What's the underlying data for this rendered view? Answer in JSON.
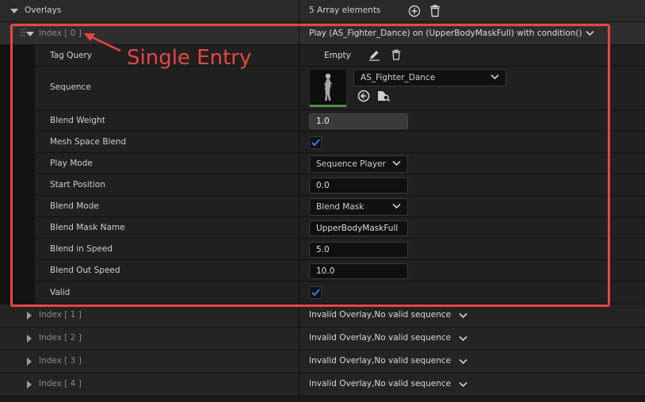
{
  "overlays": {
    "label": "Overlays",
    "summary": "5 Array elements"
  },
  "index0": {
    "label": "Index [ 0 ]",
    "value": "Play (AS_Fighter_Dance) on (UpperBodyMaskFull) with condition()"
  },
  "annotation": {
    "text": "Single Entry",
    "color": "#e84545"
  },
  "properties": {
    "tag_query": {
      "label": "Tag Query",
      "value": "Empty"
    },
    "sequence": {
      "label": "Sequence",
      "value": "AS_Fighter_Dance"
    },
    "blend_weight": {
      "label": "Blend Weight",
      "value": "1.0"
    },
    "mesh_space_blend": {
      "label": "Mesh Space Blend",
      "checked": true
    },
    "play_mode": {
      "label": "Play Mode",
      "value": "Sequence Player"
    },
    "start_position": {
      "label": "Start Position",
      "value": "0.0"
    },
    "blend_mode": {
      "label": "Blend Mode",
      "value": "Blend Mask"
    },
    "blend_mask_name": {
      "label": "Blend Mask Name",
      "value": "UpperBodyMaskFull"
    },
    "blend_in_speed": {
      "label": "Blend in Speed",
      "value": "5.0"
    },
    "blend_out_speed": {
      "label": "Blend Out Speed",
      "value": "10.0"
    },
    "valid": {
      "label": "Valid",
      "checked": true
    }
  },
  "collapsed_entries": [
    {
      "label": "Index [ 1 ]",
      "value": "Invalid Overlay,No valid sequence"
    },
    {
      "label": "Index [ 2 ]",
      "value": "Invalid Overlay,No valid sequence"
    },
    {
      "label": "Index [ 3 ]",
      "value": "Invalid Overlay,No valid sequence"
    },
    {
      "label": "Index [ 4 ]",
      "value": "Invalid Overlay,No valid sequence"
    }
  ],
  "colors": {
    "accent_check": "#2f7bf6",
    "highlight_box": "#e84545"
  }
}
